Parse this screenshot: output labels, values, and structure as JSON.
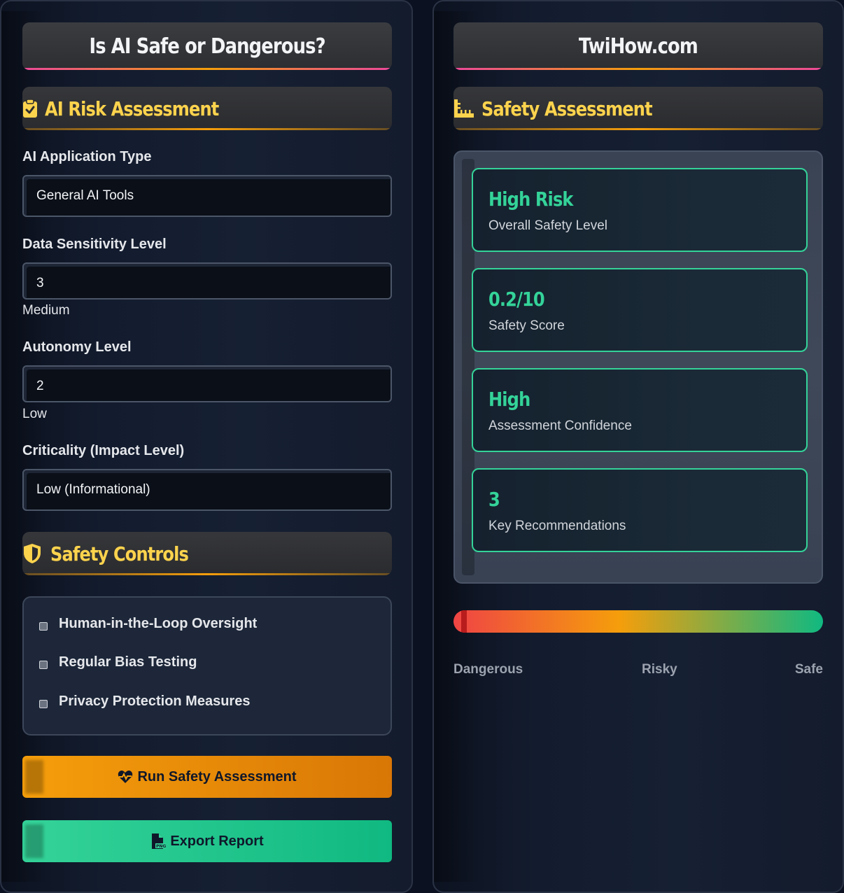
{
  "left": {
    "title": "Is AI Safe or Dangerous?",
    "risk_section": {
      "icon": "clipboard-check-icon",
      "heading": "AI Risk Assessment"
    },
    "app_type": {
      "label": "AI Application Type",
      "value": "General AI Tools"
    },
    "data_sensitivity": {
      "label": "Data Sensitivity Level",
      "value": "3",
      "hint": "Medium"
    },
    "autonomy": {
      "label": "Autonomy Level",
      "value": "2",
      "hint": "Low"
    },
    "criticality": {
      "label": "Criticality (Impact Level)",
      "value": "Low (Informational)"
    },
    "controls_section": {
      "icon": "shield-icon",
      "heading": "Safety Controls",
      "items": [
        {
          "label": "Human-in-the-Loop Oversight"
        },
        {
          "label": "Regular Bias Testing"
        },
        {
          "label": "Privacy Protection Measures"
        }
      ]
    },
    "run_button": {
      "icon": "heart-pulse-icon",
      "label": "Run Safety Assessment",
      "color": "#f59e0b"
    },
    "export_button": {
      "icon": "file-png-icon",
      "label": "Export Report",
      "color": "#34d399"
    }
  },
  "right": {
    "title": "TwiHow.com",
    "assessment_section": {
      "icon": "ruler-icon",
      "heading": "Safety Assessment"
    },
    "metrics": [
      {
        "value": "High Risk",
        "caption": "Overall Safety Level"
      },
      {
        "value": "0.2/10",
        "caption": "Safety Score"
      },
      {
        "value": "High",
        "caption": "Assessment Confidence"
      },
      {
        "value": "3",
        "caption": "Key Recommendations"
      }
    ],
    "gauge": {
      "level": 0.02,
      "labels": {
        "low": "Dangerous",
        "mid": "Risky",
        "high": "Safe"
      },
      "colors": {
        "danger": "#ef4444",
        "warn": "#f59e0b",
        "safe": "#10b981"
      }
    }
  }
}
